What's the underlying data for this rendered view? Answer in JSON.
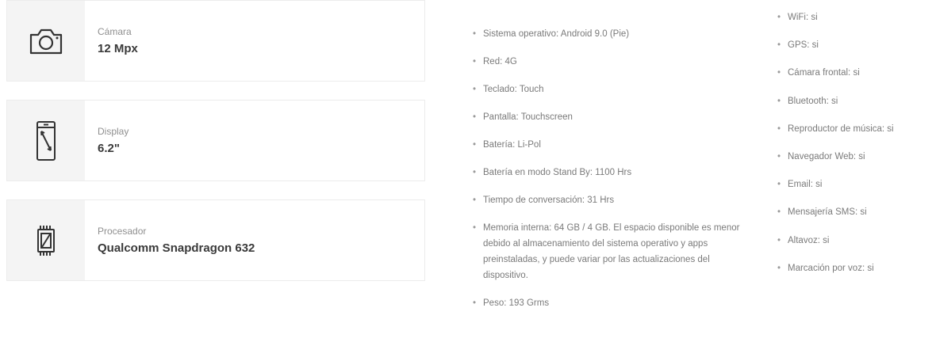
{
  "features": [
    {
      "label": "Cámara",
      "value": "12 Mpx",
      "icon": "camera-icon"
    },
    {
      "label": "Display",
      "value": "6.2\"",
      "icon": "phone-display-icon"
    },
    {
      "label": "Procesador",
      "value": "Qualcomm Snapdragon 632",
      "icon": "processor-chip-icon"
    }
  ],
  "specs_middle": [
    "Sistema operativo: Android 9.0 (Pie)",
    "Red: 4G",
    "Teclado: Touch",
    "Pantalla: Touchscreen",
    "Batería: Li-Pol",
    "Batería en modo Stand By: 1100 Hrs",
    "Tiempo de conversación: 31 Hrs",
    "Memoria interna: 64 GB / 4 GB. El espacio disponible es menor debido al almacenamiento del sistema operativo y apps preinstaladas, y puede variar por las actualizaciones del dispositivo.",
    "Peso: 193 Grms"
  ],
  "specs_right": [
    "WiFi: si",
    "GPS: si",
    "Cámara frontal: si",
    "Bluetooth: si",
    "Reproductor de música: si",
    "Navegador Web: si",
    "Email: si",
    "Mensajería SMS: si",
    "Altavoz: si",
    "Marcación por voz: si"
  ]
}
